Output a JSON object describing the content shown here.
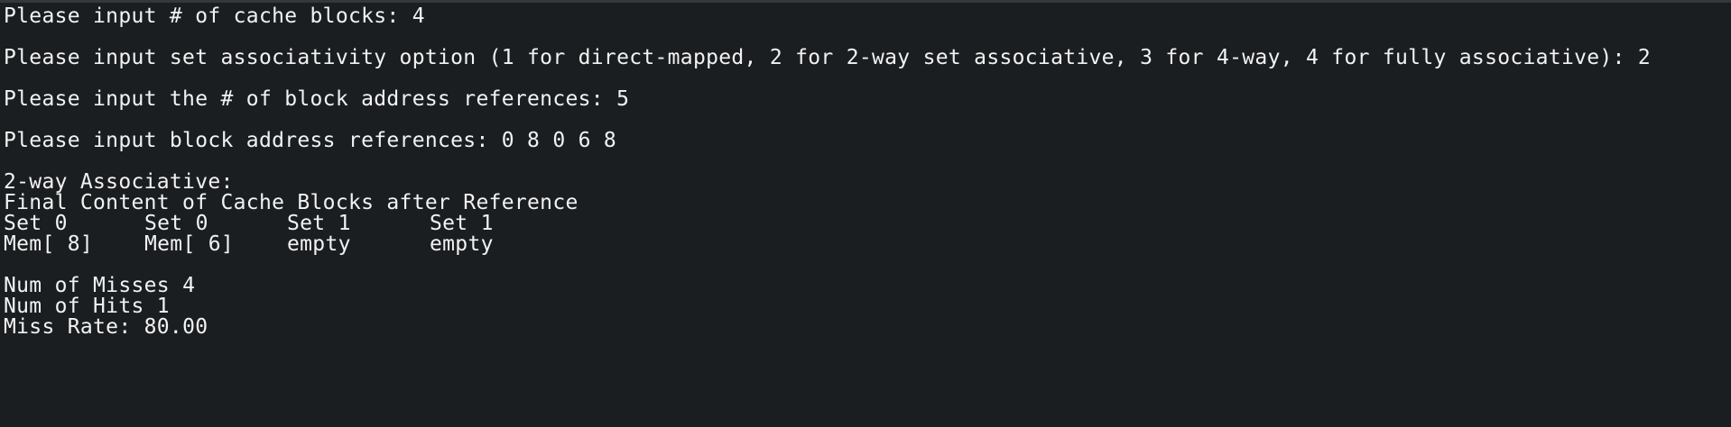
{
  "prompts": [
    {
      "label": "Please input # of cache blocks: ",
      "value": "4"
    },
    {
      "label": "Please input set associativity option (1 for direct-mapped, 2 for 2-way set associative, 3 for 4-way, 4 for fully associative): ",
      "value": "2"
    },
    {
      "label": "Please input the # of block address references: ",
      "value": "5"
    },
    {
      "label": "Please input block address references: ",
      "value": "0 8 0 6 8"
    }
  ],
  "result": {
    "mode_title": "2-way Associative:",
    "table_title": "Final Content of Cache Blocks after Reference",
    "headers": [
      "Set 0",
      "Set 0",
      "Set 1",
      "Set 1"
    ],
    "contents": [
      "Mem[ 8]",
      "Mem[ 6]",
      "empty",
      "empty"
    ]
  },
  "stats": {
    "misses_label": "Num of Misses ",
    "misses_value": "4",
    "hits_label": "Num of Hits ",
    "hits_value": "1",
    "miss_rate_label": "Miss Rate: ",
    "miss_rate_value": "80.00"
  },
  "colors": {
    "background": "#1b1e21",
    "text": "#f2f2f2"
  }
}
